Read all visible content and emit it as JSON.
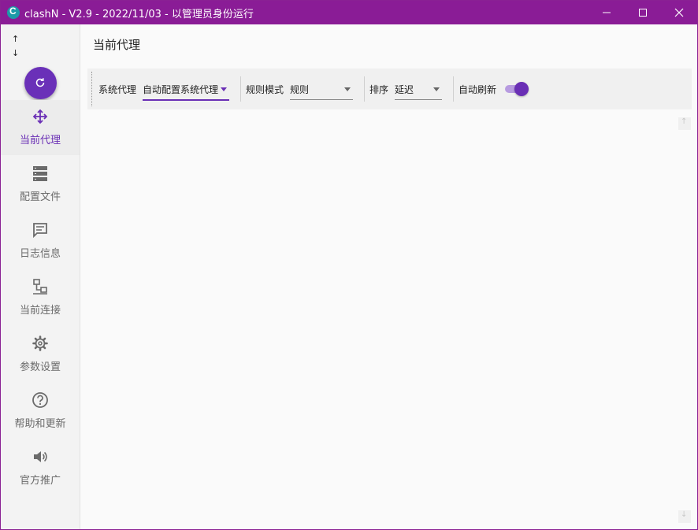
{
  "window": {
    "title": "clashN - V2.9 - 2022/11/03 - 以管理员身份运行",
    "app_icon_letter": "C",
    "titlebar_color": "#8a1c96"
  },
  "sidebar": {
    "speed_up": "↑",
    "speed_down": "↓",
    "refresh_icon": "refresh-icon",
    "items": [
      {
        "label": "当前代理",
        "icon": "proxy-move-icon",
        "active": true
      },
      {
        "label": "配置文件",
        "icon": "server-stack-icon",
        "active": false
      },
      {
        "label": "日志信息",
        "icon": "message-icon",
        "active": false
      },
      {
        "label": "当前连接",
        "icon": "lan-icon",
        "active": false
      },
      {
        "label": "参数设置",
        "icon": "gear-icon",
        "active": false
      },
      {
        "label": "帮助和更新",
        "icon": "help-circle-icon",
        "active": false
      },
      {
        "label": "官方推广",
        "icon": "speaker-icon",
        "active": false
      }
    ]
  },
  "main": {
    "title": "当前代理",
    "toolbar": {
      "system_proxy_label": "系统代理",
      "system_proxy_value": "自动配置系统代理",
      "rule_mode_label": "规则模式",
      "rule_mode_value": "规则",
      "sort_label": "排序",
      "sort_value": "延迟",
      "auto_refresh_label": "自动刷新",
      "auto_refresh_on": true
    }
  },
  "colors": {
    "accent": "#6a2fb5",
    "titlebar": "#8a1c96"
  }
}
